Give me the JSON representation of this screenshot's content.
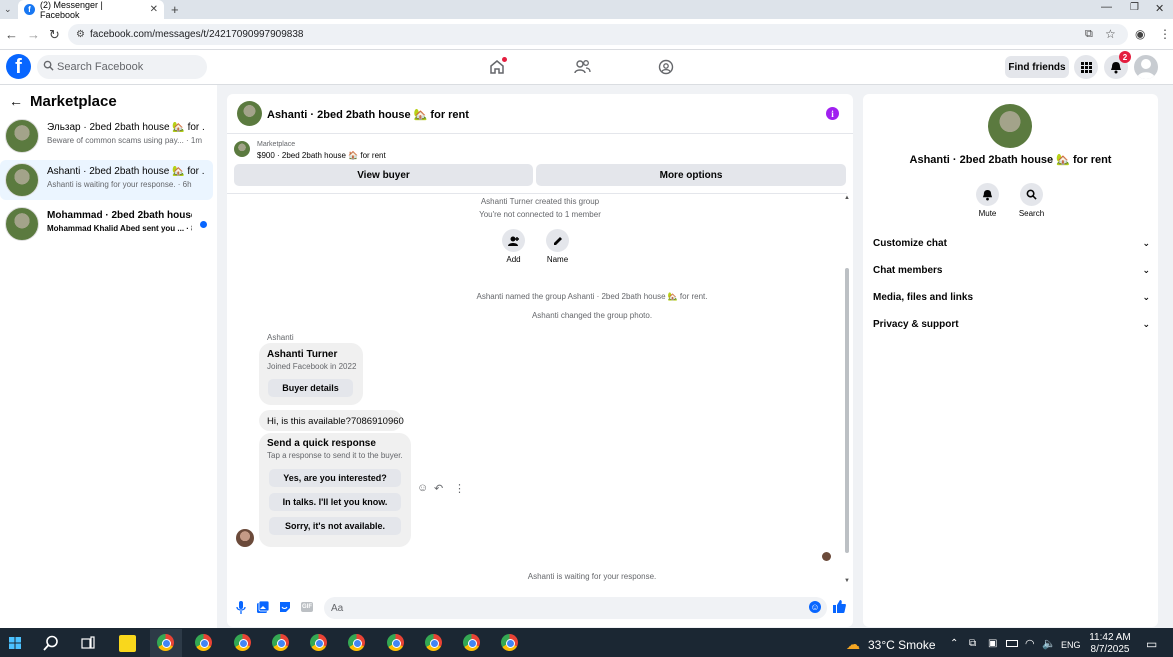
{
  "browser": {
    "tab_title": "(2) Messenger | Facebook",
    "url": "facebook.com/messages/t/24217090997909838"
  },
  "fbnav": {
    "search_placeholder": "Search Facebook",
    "find_friends": "Find friends",
    "notifications_count": "2",
    "accent": "#0866ff"
  },
  "sidebar": {
    "title": "Marketplace",
    "conversations": [
      {
        "title": "Эльзар · 2bed 2bath house 🏡 for ...",
        "preview": "Beware of common scams using pay... · 1m",
        "unread": false
      },
      {
        "title": "Ashanti · 2bed 2bath house 🏡 for ...",
        "preview": "Ashanti is waiting for your response. · 6h",
        "unread": false,
        "selected": true
      },
      {
        "title": "Mohammad · 2bed 2bath house ...",
        "preview": "Mohammad Khalid Abed sent you ... · 8h",
        "unread": true
      }
    ]
  },
  "chat": {
    "title": "Ashanti · 2bed 2bath house 🏡 for rent",
    "marketplace_label": "Marketplace",
    "listing": "$900 · 2bed 2bath house 🏠 for rent",
    "view_buyer": "View buyer",
    "more_options": "More options",
    "created": "Ashanti Turner created this group",
    "not_connected": "You're not connected to 1 member",
    "add_label": "Add",
    "name_label": "Name",
    "named_group": "Ashanti named the group Ashanti · 2bed 2bath house 🏡 for rent.",
    "changed_photo": "Ashanti changed the group photo.",
    "sender": "Ashanti",
    "card_name": "Ashanti Turner",
    "card_joined": "Joined Facebook in 2022",
    "buyer_details": "Buyer details",
    "message": "Hi, is this available?7086910960",
    "quick_title": "Send a quick response",
    "quick_sub": "Tap a response to send it to the buyer.",
    "quick_options": [
      "Yes, are you interested?",
      "In talks. I'll let you know.",
      "Sorry, it's not available."
    ],
    "waiting": "Ashanti is waiting for your response.",
    "composer_placeholder": "Aa"
  },
  "rpanel": {
    "title": "Ashanti · 2bed 2bath house 🏡 for rent",
    "mute": "Mute",
    "search": "Search",
    "sections": [
      "Customize chat",
      "Chat members",
      "Media, files and links",
      "Privacy & support"
    ]
  },
  "taskbar": {
    "weather": "33°C  Smoke",
    "lang": "ENG",
    "time": "11:42 AM",
    "date": "8/7/2025"
  }
}
